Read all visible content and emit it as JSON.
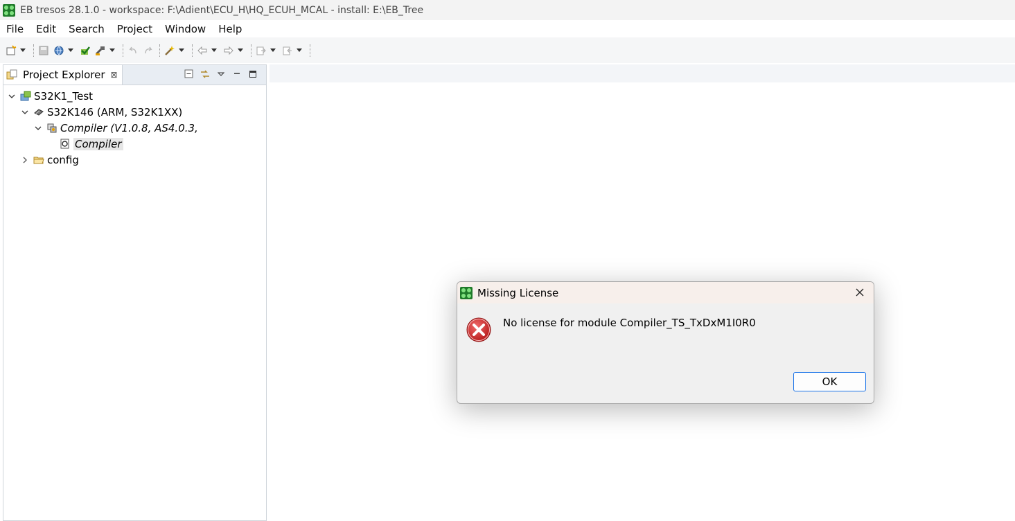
{
  "window": {
    "title": "EB tresos 28.1.0 - workspace: F:\\Adient\\ECU_H\\HQ_ECUH_MCAL - install: E:\\EB_Tree",
    "icon": "eb-tresos-app-icon"
  },
  "menu": {
    "items": [
      "File",
      "Edit",
      "Search",
      "Project",
      "Window",
      "Help"
    ]
  },
  "toolbar": {
    "icons": [
      "new-icon",
      "save-icon",
      "globe-icon",
      "check-icon",
      "build-icon",
      "undo-icon",
      "redo-icon",
      "wand-icon",
      "back-icon",
      "forward-icon",
      "import-icon",
      "export-icon"
    ]
  },
  "explorer": {
    "tab_label": "Project Explorer",
    "close_glyph": "⊠",
    "tree": [
      {
        "label": "S32K1_Test",
        "level": 0,
        "expanded": true,
        "icon": "project-icon"
      },
      {
        "label": "S32K146 (ARM, S32K1XX)",
        "level": 1,
        "expanded": true,
        "icon": "chip-icon"
      },
      {
        "label": "Compiler (V1.0.8, AS4.0.3,",
        "level": 2,
        "expanded": true,
        "icon": "module-icon",
        "italic": true
      },
      {
        "label": "Compiler",
        "level": 3,
        "icon": "config-node-icon",
        "italic": true,
        "selected": true
      },
      {
        "label": "config",
        "level": 1,
        "expanded": false,
        "icon": "folder-icon"
      }
    ]
  },
  "dialog": {
    "title": "Missing License",
    "message": "No license for module Compiler_TS_TxDxM1I0R0",
    "ok_label": "OK"
  },
  "colors": {
    "accent": "#1a73e8",
    "error": "#d32f2f"
  }
}
